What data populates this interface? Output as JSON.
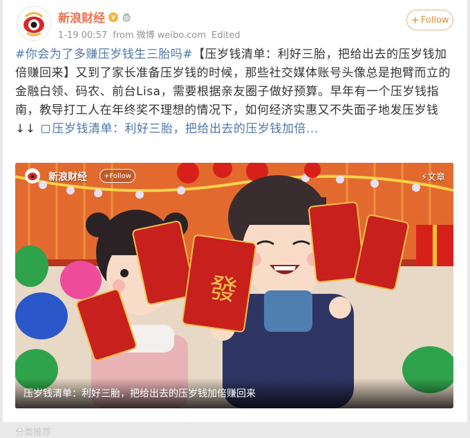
{
  "post": {
    "author": "新浪财经",
    "timestamp": "1-19 00:57",
    "source": "from 微博 weibo.com",
    "edited_label": "Edited",
    "follow_label": "Follow",
    "hashtag": "#你会为了多赚压岁钱生三胎吗#",
    "body": "【压岁钱清单：利好三胎，把给出去的压岁钱加倍赚回来】又到了家长准备压岁钱的时候，那些社交媒体账号头像总是抱臂而立的金融白领、码农、前台Lisa，需要根据亲友圈子做好预算。早年有一个压岁钱指南，教导打工人在年终奖不理想的情况下，如何经济实惠又不失面子地发压岁钱 ↓↓ ",
    "article_link": "压岁钱清单：利好三胎，把给出去的压岁钱加倍..."
  },
  "media": {
    "author": "新浪财经",
    "follow_label": "Follow",
    "type_label": "文章",
    "caption": "压岁钱清单：利好三胎，把给出去的压岁钱加倍赚回来",
    "envelope_text": "發"
  },
  "next_post": {
    "partial_text": "分类推荐"
  },
  "colors": {
    "username": "#eb7350",
    "link": "#4d76a6",
    "follow_border": "#e7b48a",
    "envelope_red": "#c8201c"
  }
}
